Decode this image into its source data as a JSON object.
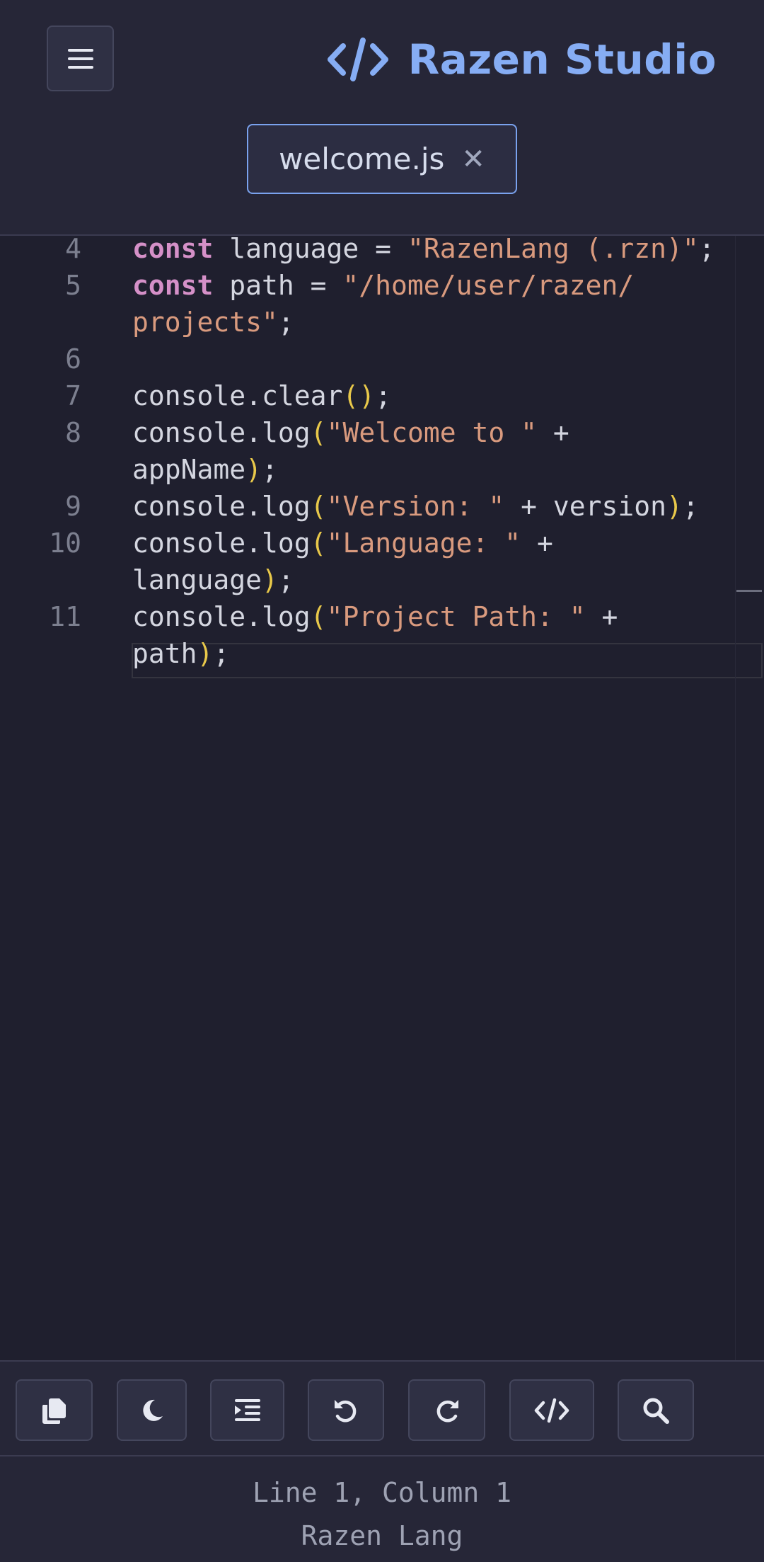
{
  "app": {
    "title": "Razen Studio",
    "accent": "#86adf4"
  },
  "icons": {
    "menu": "hamburger-icon",
    "brand": "code-brackets-icon",
    "tab_close": "close-icon"
  },
  "tab": {
    "label": "welcome.js",
    "close": "✕"
  },
  "code_lines": [
    {
      "number": "4",
      "text": "const language = \"RazenLang (.rzn)\";"
    },
    {
      "number": "5",
      "text": "const path = \"/home/user/razen/projects\";"
    },
    {
      "number": "6",
      "text": ""
    },
    {
      "number": "7",
      "text": "console.clear();"
    },
    {
      "number": "8",
      "text": "console.log(\"Welcome to \" + appName);"
    },
    {
      "number": "9",
      "text": "console.log(\"Version: \" + version);"
    },
    {
      "number": "10",
      "text": "console.log(\"Language: \" + language);"
    },
    {
      "number": "11",
      "text": "console.log(\"Project Path: \" + path);"
    }
  ],
  "toolbar": [
    {
      "name": "copy-button",
      "icon": "copy-icon"
    },
    {
      "name": "theme-toggle-button",
      "icon": "moon-icon"
    },
    {
      "name": "indent-button",
      "icon": "indent-icon"
    },
    {
      "name": "undo-button",
      "icon": "undo-icon"
    },
    {
      "name": "redo-button",
      "icon": "redo-icon"
    },
    {
      "name": "format-code-button",
      "icon": "code-icon"
    },
    {
      "name": "search-button",
      "icon": "search-icon"
    }
  ],
  "status": {
    "position": "Line 1, Column 1",
    "language": "Razen Lang"
  },
  "colors": {
    "keyword": "#d590c8",
    "string": "#d99a7e",
    "bracket": "#e8c84a",
    "text": "#d4d6e0",
    "line_number": "#7c7f8f"
  }
}
